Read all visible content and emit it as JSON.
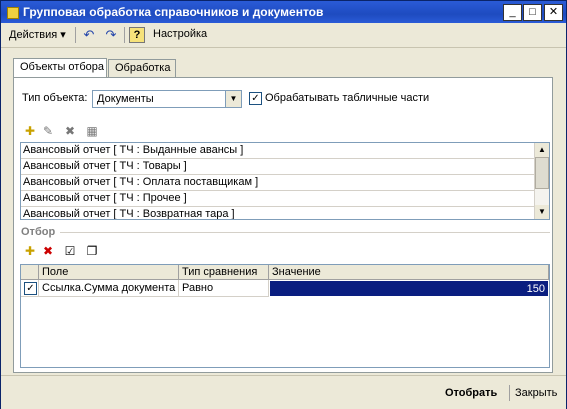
{
  "window": {
    "title": "Групповая обработка справочников и документов"
  },
  "titlebar_buttons": {
    "minimize": "_",
    "maximize": "□",
    "close": "✕"
  },
  "menu": {
    "actions_label": "Действия",
    "actions_arrow": "▾",
    "undo_glyph": "↶",
    "redo_glyph": "↷",
    "help_glyph": "?",
    "settings_label": "Настройка"
  },
  "tabs": [
    {
      "label": "Объекты отбора"
    },
    {
      "label": "Обработка"
    }
  ],
  "object_type": {
    "label": "Тип объекта:",
    "value": "Документы",
    "arrow": "▼"
  },
  "process_tables": {
    "checked": true,
    "check_glyph": "✓",
    "label": "Обрабатывать табличные части"
  },
  "list_toolbar": [
    "✚",
    "✎",
    "✖",
    "▦"
  ],
  "objects_list": [
    "Авансовый отчет [ ТЧ : Выданные авансы ]",
    "Авансовый отчет [ ТЧ : Товары ]",
    "Авансовый отчет [ ТЧ : Оплата поставщикам ]",
    "Авансовый отчет [ ТЧ : Прочее ]",
    "Авансовый отчет [ ТЧ : Возвратная тара ]"
  ],
  "scroll_arrows": {
    "up": "▲",
    "down": "▼"
  },
  "filter": {
    "title": "Отбор",
    "toolbar": [
      "✚",
      "✖",
      "☑",
      "❐"
    ],
    "columns": [
      "Поле",
      "Тип сравнения",
      "Значение"
    ],
    "rows": [
      {
        "checked": true,
        "check_glyph": "✓",
        "field": "Ссылка.Сумма документа",
        "comparison": "Равно",
        "value": "150"
      }
    ]
  },
  "footer": {
    "select_label": "Отобрать",
    "close_label": "Закрыть"
  },
  "colors": {
    "title_bar": "#2a5bd7",
    "selected_cell": "#0a1e80",
    "window_bg": "#ece9d8"
  }
}
